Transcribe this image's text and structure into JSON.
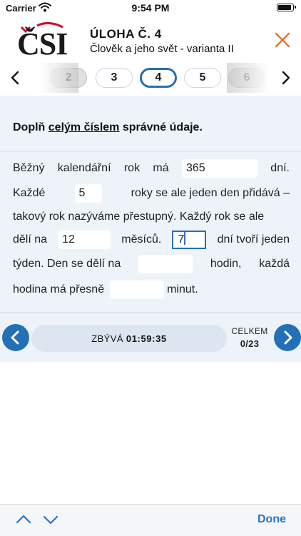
{
  "status_bar": {
    "carrier": "Carrier",
    "time": "9:54 PM",
    "battery_level": 0.9
  },
  "header": {
    "logo_text": "ČSI",
    "title": "ÚLOHA Č. 4",
    "subtitle": "Člověk a jeho svět - varianta II"
  },
  "tabs": [
    {
      "label": "2",
      "state": "faded"
    },
    {
      "label": "3",
      "state": "normal"
    },
    {
      "label": "4",
      "state": "active"
    },
    {
      "label": "5",
      "state": "normal"
    },
    {
      "label": "6",
      "state": "faded"
    }
  ],
  "instruction": {
    "before": "Doplň ",
    "underlined": "celým číslem",
    "after": " správné údaje."
  },
  "text": {
    "l1a": "Běžný",
    "l1b": "kalendářní",
    "l1c": "rok",
    "l1d": "má",
    "l1e": "dní.",
    "l2a": "Každé",
    "l2b": "roky se ale jeden den přidává –",
    "l3": "takový rok nazýváme přestupný. Každý rok se ale",
    "l4a": "dělí na",
    "l4b": "měsíců.",
    "l4c": "dní tvoří jeden",
    "l5a": "týden. Den se dělí na",
    "l5b": "hodin,",
    "l5c": "každá",
    "l6a": "hodina má přesně",
    "l6b": "minut."
  },
  "fields": {
    "days_in_year": "365",
    "leap_interval": "5",
    "months": "12",
    "days_in_week": "7",
    "hours": "",
    "minutes": ""
  },
  "bottom_nav": {
    "remaining_label": "ZBÝVÁ",
    "remaining_time": "01:59:35",
    "total_label": "CELKEM",
    "total_count": "0/23"
  },
  "keyboard_accessory": {
    "done_label": "Done"
  },
  "colors": {
    "accent": "#2370b6",
    "logo_red": "#d0102b",
    "close": "#e8722f",
    "content_bg": "#eef3fa"
  }
}
